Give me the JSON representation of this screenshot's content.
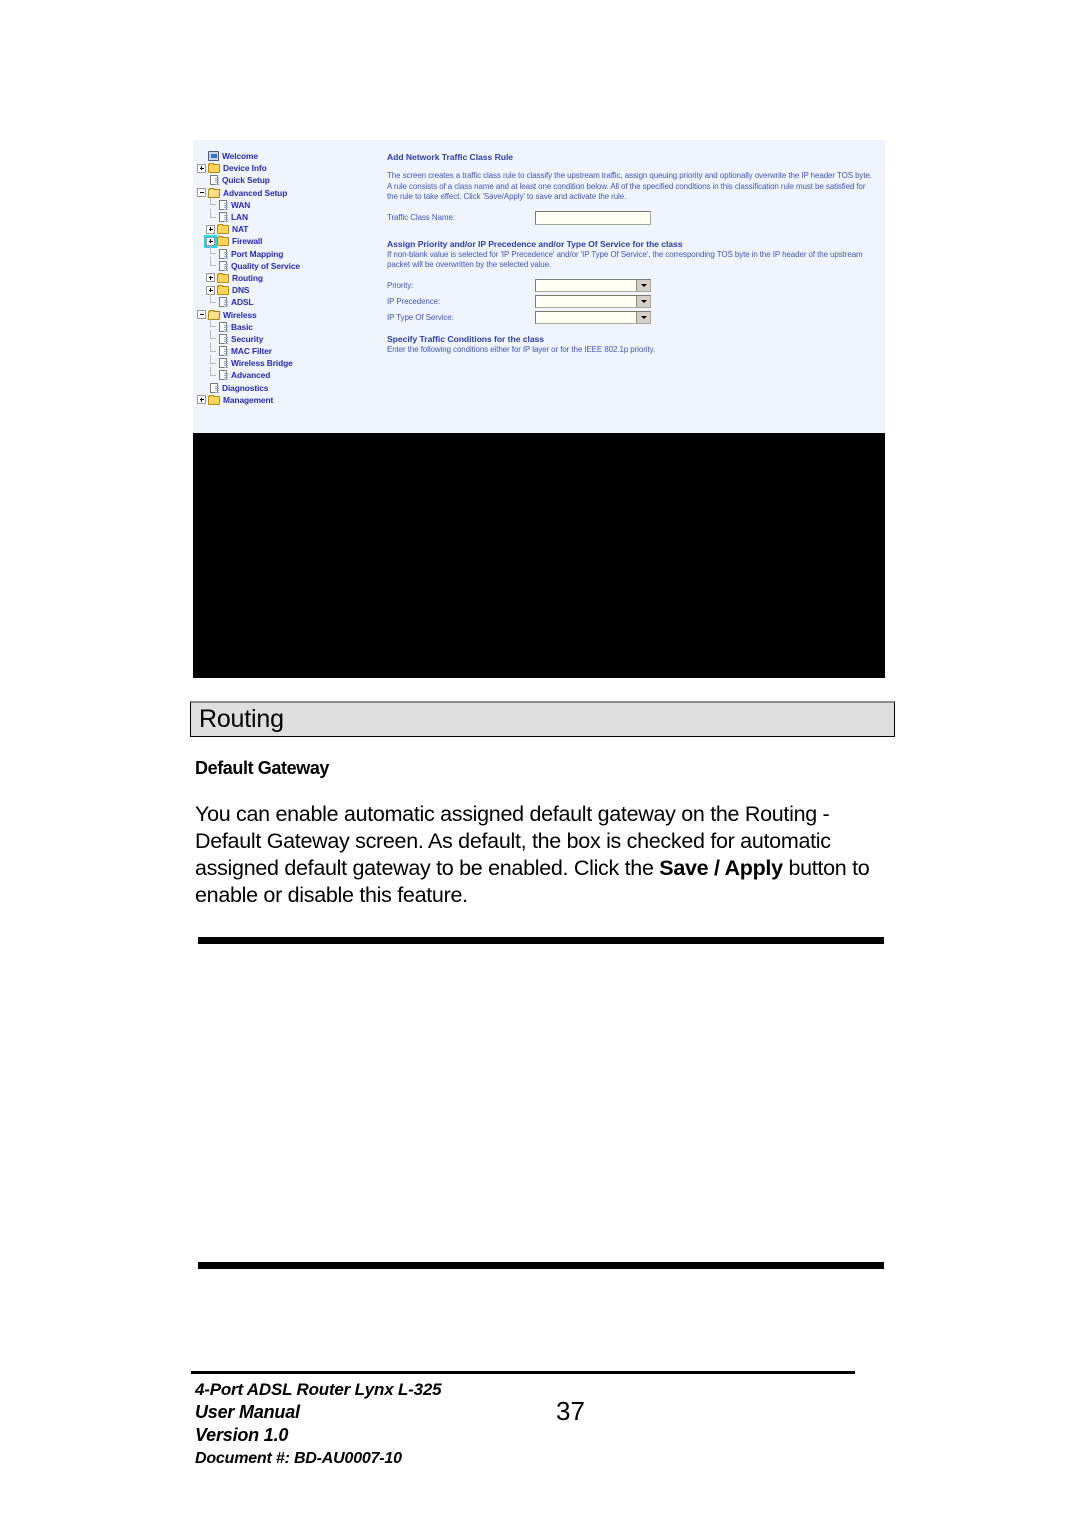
{
  "figure": {
    "nav_tree": {
      "items": [
        {
          "label": "Welcome",
          "indent": 0,
          "icon": "monitor-icon",
          "toggle": "none"
        },
        {
          "label": "Device Info",
          "indent": 0,
          "icon": "folder-icon",
          "toggle": "plus"
        },
        {
          "label": "Quick Setup",
          "indent": 0,
          "icon": "page-icon",
          "toggle": "none"
        },
        {
          "label": "Advanced Setup",
          "indent": 0,
          "icon": "folder-open-icon",
          "toggle": "minus"
        },
        {
          "label": "WAN",
          "indent": 1,
          "icon": "page-icon",
          "toggle": "none"
        },
        {
          "label": "LAN",
          "indent": 1,
          "icon": "page-icon",
          "toggle": "none"
        },
        {
          "label": "NAT",
          "indent": 1,
          "icon": "folder-icon",
          "toggle": "plus"
        },
        {
          "label": "Firewall",
          "indent": 1,
          "icon": "folder-icon",
          "toggle": "plus",
          "highlighted": true
        },
        {
          "label": "Port Mapping",
          "indent": 1,
          "icon": "page-icon",
          "toggle": "none"
        },
        {
          "label": "Quality of Service",
          "indent": 1,
          "icon": "page-icon",
          "toggle": "none"
        },
        {
          "label": "Routing",
          "indent": 1,
          "icon": "folder-icon",
          "toggle": "plus"
        },
        {
          "label": "DNS",
          "indent": 1,
          "icon": "folder-icon",
          "toggle": "plus"
        },
        {
          "label": "ADSL",
          "indent": 1,
          "icon": "page-icon",
          "toggle": "none"
        },
        {
          "label": "Wireless",
          "indent": 0,
          "icon": "folder-open-icon",
          "toggle": "minus"
        },
        {
          "label": "Basic",
          "indent": 1,
          "icon": "page-icon",
          "toggle": "none"
        },
        {
          "label": "Security",
          "indent": 1,
          "icon": "page-icon",
          "toggle": "none"
        },
        {
          "label": "MAC Filter",
          "indent": 1,
          "icon": "page-icon",
          "toggle": "none"
        },
        {
          "label": "Wireless Bridge",
          "indent": 1,
          "icon": "page-icon",
          "toggle": "none"
        },
        {
          "label": "Advanced",
          "indent": 1,
          "icon": "page-icon",
          "toggle": "none"
        },
        {
          "label": "Diagnostics",
          "indent": 0,
          "icon": "page-icon",
          "toggle": "none"
        },
        {
          "label": "Management",
          "indent": 0,
          "icon": "folder-icon",
          "toggle": "plus"
        }
      ]
    },
    "content": {
      "title": "Add Network Traffic Class Rule",
      "intro": "The screen creates a traffic class rule to classify the upstream traffic, assign queuing priority and optionally overwrite the IP header TOS byte. A rule consists of a class name and at least one condition below. All of the specified conditions in this classification rule must be satisfied for the rule to take effect. Click 'Save/Apply' to save and activate the rule.",
      "traffic_class_name_label": "Traffic Class Name:",
      "traffic_class_name_value": "",
      "assign_heading": "Assign Priority and/or IP Precedence and/or Type Of Service for the class",
      "assign_note": "If non-blank value is selected for 'IP Precedence' and/or 'IP Type Of Service', the corresponding TOS byte in the IP header of the upstream packet will be overwritten by the selected value.",
      "priority_label": "Priority:",
      "priority_value": "",
      "ip_precedence_label": "IP Precedence:",
      "ip_precedence_value": "",
      "ip_tos_label": "IP Type Of Service:",
      "ip_tos_value": "",
      "conditions_heading": "Specify Traffic Conditions for the class",
      "conditions_note": "Enter the following conditions either for IP layer or for the IEEE 802.1p priority."
    },
    "colors": {
      "panel_background": "#f0f4fd",
      "link_text": "#2b2bb5",
      "heading_text": "#2e3fa8",
      "highlight_outline": "#21d7e8",
      "blackout": "#000000"
    }
  },
  "document": {
    "heading": "Routing",
    "subheading": "Default Gateway",
    "paragraph_part1": "You can enable automatic assigned default gateway on the Routing - Default Gateway screen.  As default, the box is checked for automatic assigned default gateway to be enabled.  Click the ",
    "paragraph_bold": "Save / Apply",
    "paragraph_part2": " button to enable or disable this feature.",
    "heading_background": "#dedede"
  },
  "footer": {
    "line1": "4-Port ADSL Router Lynx L-325",
    "line2": "User Manual",
    "line3": "Version 1.0",
    "line4": "Document #:  BD-AU0007-10",
    "page_number": "37"
  }
}
